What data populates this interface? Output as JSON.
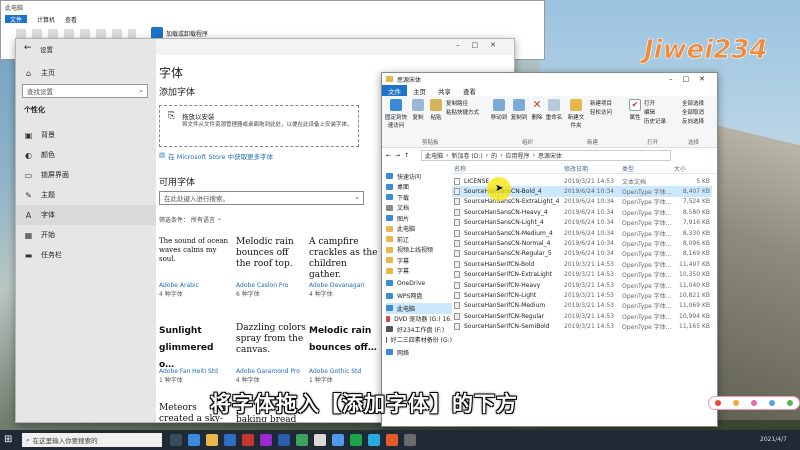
{
  "background_window": {
    "title": "此电脑",
    "tabs": [
      "文件",
      "计算机",
      "查看"
    ],
    "items": [
      "加载或卸载程序"
    ]
  },
  "settings": {
    "title": "设置",
    "home": "主页",
    "search_placeholder": "查找设置",
    "section": "个性化",
    "nav": [
      {
        "icon": "image-icon",
        "label": "背景"
      },
      {
        "icon": "palette-icon",
        "label": "颜色"
      },
      {
        "icon": "lock-screen-icon",
        "label": "锁屏界面"
      },
      {
        "icon": "theme-icon",
        "label": "主题"
      },
      {
        "icon": "font-icon",
        "label": "字体"
      },
      {
        "icon": "start-icon",
        "label": "开始"
      },
      {
        "icon": "taskbar-icon",
        "label": "任务栏"
      }
    ],
    "page_title": "字体",
    "add_font_heading": "添加字体",
    "drop_title": "拖放以安装",
    "drop_desc": "将文件从文件资源管理器或桌面拖到此处，以便在此设备上安装字体。",
    "store_link": "在 Microsoft Store 中获取更多字体",
    "available_heading": "可用字体",
    "search_fonts_placeholder": "在此处键入进行搜索。",
    "filter_label": "筛选条件：",
    "filter_value": "所有语言",
    "fonts": [
      {
        "sample": "The sound of ocean waves calms my soul.",
        "name": "Adobe Arabic",
        "faces": "4 种字体"
      },
      {
        "sample": "Melodic rain bounces off the roof top.",
        "name": "Adobe Caslon Pro",
        "faces": "6 种字体"
      },
      {
        "sample": "A campfire crackles as the children gather.",
        "name": "Adobe Devanagari",
        "faces": "4 种字体"
      },
      {
        "sample": "Sunlight glimmered o…",
        "name": "Adobe Fan Heiti Std",
        "faces": "1 种字体"
      },
      {
        "sample": "Dazzling colors spray from the canvas.",
        "name": "Adobe Garamond Pro",
        "faces": "4 种字体"
      },
      {
        "sample": "Melodic rain bounces off…",
        "name": "Adobe Gothic Std",
        "faces": "1 种字体"
      },
      {
        "sample": "Meteors created a sky-symphony of",
        "name": "",
        "faces": ""
      },
      {
        "sample": "baking bread fills",
        "name": "",
        "faces": ""
      }
    ]
  },
  "explorer": {
    "title": "思源宋体",
    "tabs": [
      "文件",
      "主页",
      "共享",
      "查看"
    ],
    "ribbon": {
      "pin": "固定到快速访问",
      "copy": "复制",
      "paste": "粘贴",
      "copy_path": "复制路径",
      "paste_shortcut": "粘贴快捷方式",
      "move_to": "移动到",
      "copy_to": "复制到",
      "delete": "删除",
      "rename": "重命名",
      "new_folder": "新建文件夹",
      "new_item": "新建项目",
      "easy_access": "轻松访问",
      "properties": "属性",
      "open": "打开",
      "edit": "编辑",
      "history": "历史记录",
      "select_all": "全部选择",
      "select_none": "全部取消",
      "invert": "反向选择",
      "group_clipboard": "剪贴板",
      "group_organize": "组织",
      "group_new": "新建",
      "group_open": "打开",
      "group_select": "选择"
    },
    "breadcrumb": [
      "此电脑",
      "新加卷 (D:)",
      "的",
      "应用程序",
      "思源宋体"
    ],
    "columns": [
      "名称",
      "修改日期",
      "类型",
      "大小"
    ],
    "tree": [
      {
        "icon": "star-icon",
        "label": "快速访问",
        "color": "#3b8ad9"
      },
      {
        "icon": "desktop-icon",
        "label": "桌面",
        "color": "#3b8ad9"
      },
      {
        "icon": "download-icon",
        "label": "下载",
        "color": "#3b8ad9"
      },
      {
        "icon": "document-icon",
        "label": "文档",
        "color": "#8a8a8a"
      },
      {
        "icon": "picture-icon",
        "label": "图片",
        "color": "#3b8ad9"
      },
      {
        "icon": "folder-icon",
        "label": "此电脑",
        "color": "#e8b94a"
      },
      {
        "icon": "folder-icon",
        "label": "前辽",
        "color": "#e8b94a"
      },
      {
        "icon": "folder-icon",
        "label": "视频上线视频",
        "color": "#e8b94a"
      },
      {
        "icon": "folder-icon",
        "label": "字幕",
        "color": "#e8b94a"
      },
      {
        "icon": "folder-icon",
        "label": "字幕",
        "color": "#e8b94a"
      },
      {
        "icon": "cloud-icon",
        "label": "OneDrive",
        "color": "#3b8ad9"
      },
      {
        "icon": "cloud-icon",
        "label": "WPS网盘",
        "color": "#3b8ad9"
      },
      {
        "icon": "computer-icon",
        "label": "此电脑",
        "color": "#3b8ad9"
      },
      {
        "icon": "dvd-icon",
        "label": "DVD 驱动器 (G:) 16.",
        "color": "#d24a3a"
      },
      {
        "icon": "drive-icon",
        "label": "好234工作盘 (F:)",
        "color": "#555"
      },
      {
        "icon": "drive-icon",
        "label": "好二三四素材备份 (G:)",
        "color": "#555"
      },
      {
        "icon": "network-icon",
        "label": "网络",
        "color": "#3b8ad9"
      }
    ],
    "files": [
      {
        "name": "LICENSE",
        "date": "2019/3/21 14:53",
        "type": "文本文档",
        "size": "5 KB"
      },
      {
        "name": "SourceHanSansCN-Bold_4",
        "date": "2019/6/24 10:34",
        "type": "OpenType 字体...",
        "size": "8,407 KB"
      },
      {
        "name": "SourceHanSansCN-ExtraLight_4",
        "date": "2019/6/24 10:34",
        "type": "OpenType 字体...",
        "size": "7,524 KB"
      },
      {
        "name": "SourceHanSansCN-Heavy_4",
        "date": "2019/6/24 10:34",
        "type": "OpenType 字体...",
        "size": "8,580 KB"
      },
      {
        "name": "SourceHanSansCN-Light_4",
        "date": "2019/6/24 10:34",
        "type": "OpenType 字体...",
        "size": "7,916 KB"
      },
      {
        "name": "SourceHanSansCN-Medium_4",
        "date": "2019/6/24 10:34",
        "type": "OpenType 字体...",
        "size": "8,330 KB"
      },
      {
        "name": "SourceHanSansCN-Normal_4",
        "date": "2019/6/24 10:34",
        "type": "OpenType 字体...",
        "size": "8,096 KB"
      },
      {
        "name": "SourceHanSansCN-Regular_5",
        "date": "2019/6/24 10:34",
        "type": "OpenType 字体...",
        "size": "8,169 KB"
      },
      {
        "name": "SourceHanSerifCN-Bold",
        "date": "2019/3/21 14:53",
        "type": "OpenType 字体...",
        "size": "11,497 KB"
      },
      {
        "name": "SourceHanSerifCN-ExtraLight",
        "date": "2019/3/21 14:53",
        "type": "OpenType 字体...",
        "size": "10,350 KB"
      },
      {
        "name": "SourceHanSerifCN-Heavy",
        "date": "2019/3/21 14:53",
        "type": "OpenType 字体...",
        "size": "11,040 KB"
      },
      {
        "name": "SourceHanSerifCN-Light",
        "date": "2019/3/21 14:53",
        "type": "OpenType 字体...",
        "size": "10,821 KB"
      },
      {
        "name": "SourceHanSerifCN-Medium",
        "date": "2019/3/21 14:53",
        "type": "OpenType 字体...",
        "size": "11,069 KB"
      },
      {
        "name": "SourceHanSerifCN-Regular",
        "date": "2019/3/21 14:53",
        "type": "OpenType 字体...",
        "size": "10,994 KB"
      },
      {
        "name": "SourceHanSerifCN-SemiBold",
        "date": "2019/3/21 14:53",
        "type": "OpenType 字体...",
        "size": "11,165 KB"
      }
    ]
  },
  "taskbar": {
    "search_placeholder": "在这里输入你要搜索的",
    "time": "2021/4/7"
  },
  "caption": "将字体拖入【添加字体】的下方",
  "watermark": "Jiwei234",
  "colors": {
    "accent": "#1d73c9",
    "selection": "#cce8ff",
    "highlight": "#f5e600"
  }
}
